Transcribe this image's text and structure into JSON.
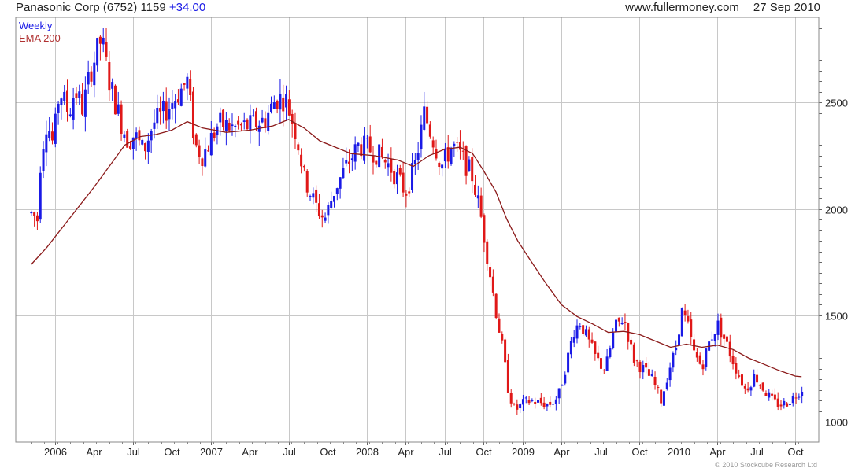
{
  "header": {
    "company": "Panasonic Corp",
    "ticker": "(6752)",
    "price": "1159",
    "change": "+34.00",
    "website": "www.fullermoney.com",
    "date": "27 Sep 2010"
  },
  "copyright": "© 2010 Stockcube Research Ltd",
  "colors": {
    "up": "#1a1ae6",
    "down": "#e01818",
    "ema": "#8b1a1a",
    "grid": "#c8c8c8",
    "legend_weekly": "#1a1ae6",
    "legend_ema": "#b03030"
  },
  "chart_data": {
    "type": "line",
    "legend": [
      "Weekly",
      "EMA 200"
    ],
    "legend_placement": "top-left",
    "ylim": [
      905,
      2900
    ],
    "yticks": [
      1000,
      1500,
      2000,
      2500
    ],
    "grid": true,
    "xticks": [
      {
        "t": 0.15,
        "label": "2006"
      },
      {
        "t": 0.4,
        "label": "Apr"
      },
      {
        "t": 0.65,
        "label": "Jul"
      },
      {
        "t": 0.9,
        "label": "Oct"
      },
      {
        "t": 1.15,
        "label": "2007"
      },
      {
        "t": 1.4,
        "label": "Apr"
      },
      {
        "t": 1.65,
        "label": "Jul"
      },
      {
        "t": 1.9,
        "label": "Oct"
      },
      {
        "t": 2.15,
        "label": "2008"
      },
      {
        "t": 2.4,
        "label": "Apr"
      },
      {
        "t": 2.65,
        "label": "Jul"
      },
      {
        "t": 2.9,
        "label": "Oct"
      },
      {
        "t": 3.15,
        "label": "2009"
      },
      {
        "t": 3.4,
        "label": "Apr"
      },
      {
        "t": 3.65,
        "label": "Jul"
      },
      {
        "t": 3.9,
        "label": "Oct"
      },
      {
        "t": 4.15,
        "label": "2010"
      },
      {
        "t": 4.4,
        "label": "Apr"
      },
      {
        "t": 4.65,
        "label": "Jul"
      },
      {
        "t": 4.9,
        "label": "Oct"
      }
    ],
    "price_path": [
      {
        "t": 0.0,
        "v": 1980
      },
      {
        "t": 0.04,
        "v": 1950
      },
      {
        "t": 0.06,
        "v": 2250
      },
      {
        "t": 0.1,
        "v": 2420
      },
      {
        "t": 0.14,
        "v": 2300
      },
      {
        "t": 0.18,
        "v": 2560
      },
      {
        "t": 0.24,
        "v": 2450
      },
      {
        "t": 0.28,
        "v": 2560
      },
      {
        "t": 0.33,
        "v": 2470
      },
      {
        "t": 0.38,
        "v": 2650
      },
      {
        "t": 0.45,
        "v": 2800
      },
      {
        "t": 0.5,
        "v": 2600
      },
      {
        "t": 0.57,
        "v": 2420
      },
      {
        "t": 0.62,
        "v": 2320
      },
      {
        "t": 0.66,
        "v": 2350
      },
      {
        "t": 0.72,
        "v": 2270
      },
      {
        "t": 0.78,
        "v": 2400
      },
      {
        "t": 0.85,
        "v": 2450
      },
      {
        "t": 0.92,
        "v": 2520
      },
      {
        "t": 1.0,
        "v": 2600
      },
      {
        "t": 1.05,
        "v": 2300
      },
      {
        "t": 1.1,
        "v": 2250
      },
      {
        "t": 1.2,
        "v": 2400
      },
      {
        "t": 1.3,
        "v": 2380
      },
      {
        "t": 1.4,
        "v": 2390
      },
      {
        "t": 1.5,
        "v": 2420
      },
      {
        "t": 1.57,
        "v": 2520
      },
      {
        "t": 1.63,
        "v": 2520
      },
      {
        "t": 1.7,
        "v": 2350
      },
      {
        "t": 1.75,
        "v": 2150
      },
      {
        "t": 1.82,
        "v": 2020
      },
      {
        "t": 1.88,
        "v": 1950
      },
      {
        "t": 1.95,
        "v": 2100
      },
      {
        "t": 2.02,
        "v": 2200
      },
      {
        "t": 2.1,
        "v": 2300
      },
      {
        "t": 2.2,
        "v": 2270
      },
      {
        "t": 2.3,
        "v": 2200
      },
      {
        "t": 2.4,
        "v": 2080
      },
      {
        "t": 2.46,
        "v": 2200
      },
      {
        "t": 2.52,
        "v": 2450
      },
      {
        "t": 2.58,
        "v": 2320
      },
      {
        "t": 2.63,
        "v": 2200
      },
      {
        "t": 2.7,
        "v": 2300
      },
      {
        "t": 2.78,
        "v": 2220
      },
      {
        "t": 2.83,
        "v": 2150
      },
      {
        "t": 2.88,
        "v": 1980
      },
      {
        "t": 2.92,
        "v": 1800
      },
      {
        "t": 2.98,
        "v": 1520
      },
      {
        "t": 3.02,
        "v": 1350
      },
      {
        "t": 3.06,
        "v": 1150
      },
      {
        "t": 3.1,
        "v": 1050
      },
      {
        "t": 3.14,
        "v": 1080
      },
      {
        "t": 3.2,
        "v": 1100
      },
      {
        "t": 3.26,
        "v": 1090
      },
      {
        "t": 3.32,
        "v": 1080
      },
      {
        "t": 3.38,
        "v": 1120
      },
      {
        "t": 3.44,
        "v": 1300
      },
      {
        "t": 3.48,
        "v": 1430
      },
      {
        "t": 3.52,
        "v": 1470
      },
      {
        "t": 3.56,
        "v": 1400
      },
      {
        "t": 3.62,
        "v": 1300
      },
      {
        "t": 3.68,
        "v": 1240
      },
      {
        "t": 3.74,
        "v": 1440
      },
      {
        "t": 3.8,
        "v": 1490
      },
      {
        "t": 3.86,
        "v": 1300
      },
      {
        "t": 3.92,
        "v": 1250
      },
      {
        "t": 3.98,
        "v": 1200
      },
      {
        "t": 4.04,
        "v": 1100
      },
      {
        "t": 4.09,
        "v": 1250
      },
      {
        "t": 4.13,
        "v": 1330
      },
      {
        "t": 4.17,
        "v": 1520
      },
      {
        "t": 4.21,
        "v": 1450
      },
      {
        "t": 4.25,
        "v": 1320
      },
      {
        "t": 4.3,
        "v": 1260
      },
      {
        "t": 4.35,
        "v": 1380
      },
      {
        "t": 4.4,
        "v": 1460
      },
      {
        "t": 4.45,
        "v": 1380
      },
      {
        "t": 4.52,
        "v": 1250
      },
      {
        "t": 4.58,
        "v": 1150
      },
      {
        "t": 4.64,
        "v": 1220
      },
      {
        "t": 4.7,
        "v": 1150
      },
      {
        "t": 4.76,
        "v": 1090
      },
      {
        "t": 4.82,
        "v": 1080
      },
      {
        "t": 4.88,
        "v": 1110
      },
      {
        "t": 4.94,
        "v": 1159
      }
    ],
    "ema_path": [
      {
        "t": 0.0,
        "v": 1740
      },
      {
        "t": 0.1,
        "v": 1820
      },
      {
        "t": 0.25,
        "v": 1960
      },
      {
        "t": 0.4,
        "v": 2100
      },
      {
        "t": 0.5,
        "v": 2200
      },
      {
        "t": 0.6,
        "v": 2300
      },
      {
        "t": 0.7,
        "v": 2340
      },
      {
        "t": 0.8,
        "v": 2350
      },
      {
        "t": 0.9,
        "v": 2370
      },
      {
        "t": 1.0,
        "v": 2410
      },
      {
        "t": 1.1,
        "v": 2380
      },
      {
        "t": 1.25,
        "v": 2360
      },
      {
        "t": 1.4,
        "v": 2370
      },
      {
        "t": 1.55,
        "v": 2390
      },
      {
        "t": 1.65,
        "v": 2420
      },
      {
        "t": 1.75,
        "v": 2380
      },
      {
        "t": 1.85,
        "v": 2320
      },
      {
        "t": 1.95,
        "v": 2290
      },
      {
        "t": 2.05,
        "v": 2260
      },
      {
        "t": 2.2,
        "v": 2250
      },
      {
        "t": 2.35,
        "v": 2230
      },
      {
        "t": 2.45,
        "v": 2200
      },
      {
        "t": 2.55,
        "v": 2250
      },
      {
        "t": 2.65,
        "v": 2280
      },
      {
        "t": 2.75,
        "v": 2290
      },
      {
        "t": 2.83,
        "v": 2260
      },
      {
        "t": 2.9,
        "v": 2180
      },
      {
        "t": 2.98,
        "v": 2080
      },
      {
        "t": 3.05,
        "v": 1950
      },
      {
        "t": 3.12,
        "v": 1850
      },
      {
        "t": 3.2,
        "v": 1760
      },
      {
        "t": 3.3,
        "v": 1650
      },
      {
        "t": 3.4,
        "v": 1550
      },
      {
        "t": 3.5,
        "v": 1495
      },
      {
        "t": 3.6,
        "v": 1460
      },
      {
        "t": 3.7,
        "v": 1420
      },
      {
        "t": 3.8,
        "v": 1425
      },
      {
        "t": 3.9,
        "v": 1410
      },
      {
        "t": 4.0,
        "v": 1380
      },
      {
        "t": 4.1,
        "v": 1350
      },
      {
        "t": 4.2,
        "v": 1365
      },
      {
        "t": 4.3,
        "v": 1350
      },
      {
        "t": 4.4,
        "v": 1360
      },
      {
        "t": 4.5,
        "v": 1340
      },
      {
        "t": 4.6,
        "v": 1300
      },
      {
        "t": 4.7,
        "v": 1270
      },
      {
        "t": 4.8,
        "v": 1240
      },
      {
        "t": 4.9,
        "v": 1215
      },
      {
        "t": 4.94,
        "v": 1212
      }
    ]
  }
}
